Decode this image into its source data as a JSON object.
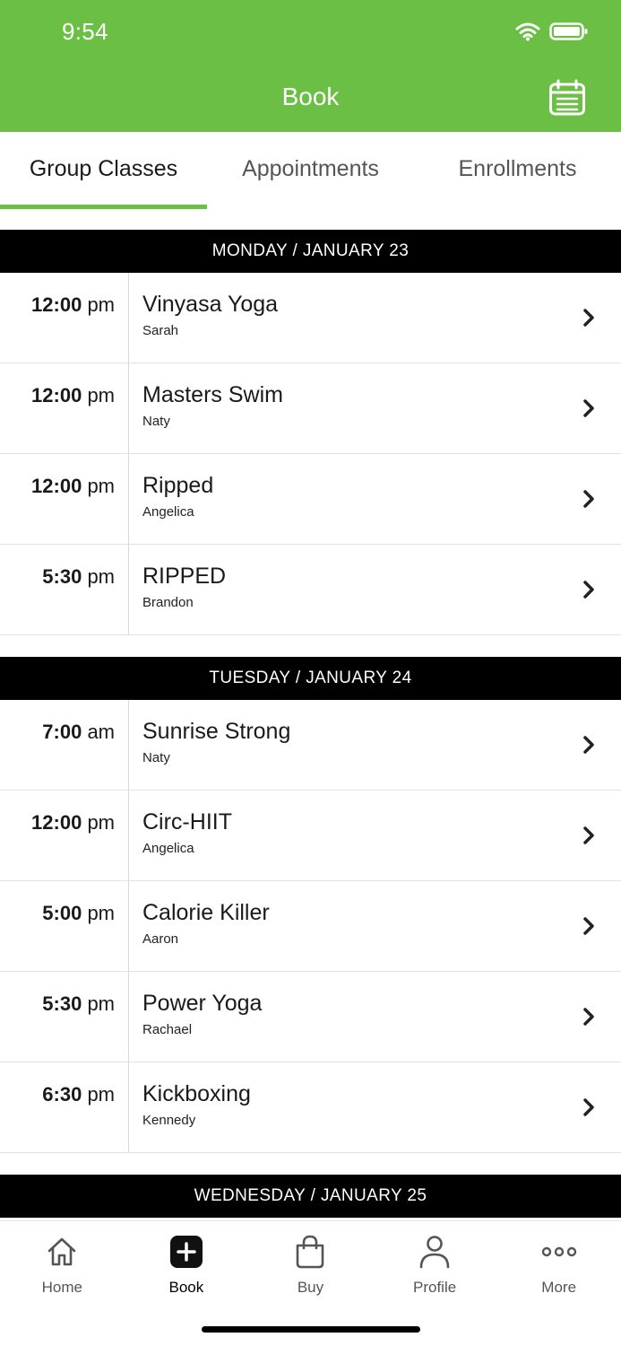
{
  "status": {
    "time": "9:54"
  },
  "header": {
    "title": "Book"
  },
  "tabs": [
    {
      "label": "Group Classes",
      "active": true
    },
    {
      "label": "Appointments",
      "active": false
    },
    {
      "label": "Enrollments",
      "active": false
    }
  ],
  "days": [
    {
      "label": "MONDAY / JANUARY 23",
      "classes": [
        {
          "time": "12:00",
          "ampm": "pm",
          "name": "Vinyasa Yoga",
          "instructor": "Sarah"
        },
        {
          "time": "12:00",
          "ampm": "pm",
          "name": "Masters Swim",
          "instructor": "Naty"
        },
        {
          "time": "12:00",
          "ampm": "pm",
          "name": "Ripped",
          "instructor": "Angelica"
        },
        {
          "time": "5:30",
          "ampm": "pm",
          "name": "RIPPED",
          "instructor": "Brandon"
        }
      ]
    },
    {
      "label": "TUESDAY / JANUARY 24",
      "classes": [
        {
          "time": "7:00",
          "ampm": "am",
          "name": "Sunrise Strong",
          "instructor": "Naty"
        },
        {
          "time": "12:00",
          "ampm": "pm",
          "name": "Circ-HIIT",
          "instructor": "Angelica"
        },
        {
          "time": "5:00",
          "ampm": "pm",
          "name": "Calorie Killer",
          "instructor": "Aaron"
        },
        {
          "time": "5:30",
          "ampm": "pm",
          "name": "Power Yoga",
          "instructor": "Rachael"
        },
        {
          "time": "6:30",
          "ampm": "pm",
          "name": "Kickboxing",
          "instructor": "Kennedy"
        }
      ]
    },
    {
      "label": "WEDNESDAY / JANUARY 25",
      "classes": []
    }
  ],
  "nav": [
    {
      "label": "Home",
      "icon": "home-icon",
      "active": false
    },
    {
      "label": "Book",
      "icon": "plus-square-icon",
      "active": true
    },
    {
      "label": "Buy",
      "icon": "shopping-bag-icon",
      "active": false
    },
    {
      "label": "Profile",
      "icon": "person-icon",
      "active": false
    },
    {
      "label": "More",
      "icon": "more-dots-icon",
      "active": false
    }
  ],
  "colors": {
    "brand": "#6cbf45",
    "day_header_bg": "#000000"
  }
}
